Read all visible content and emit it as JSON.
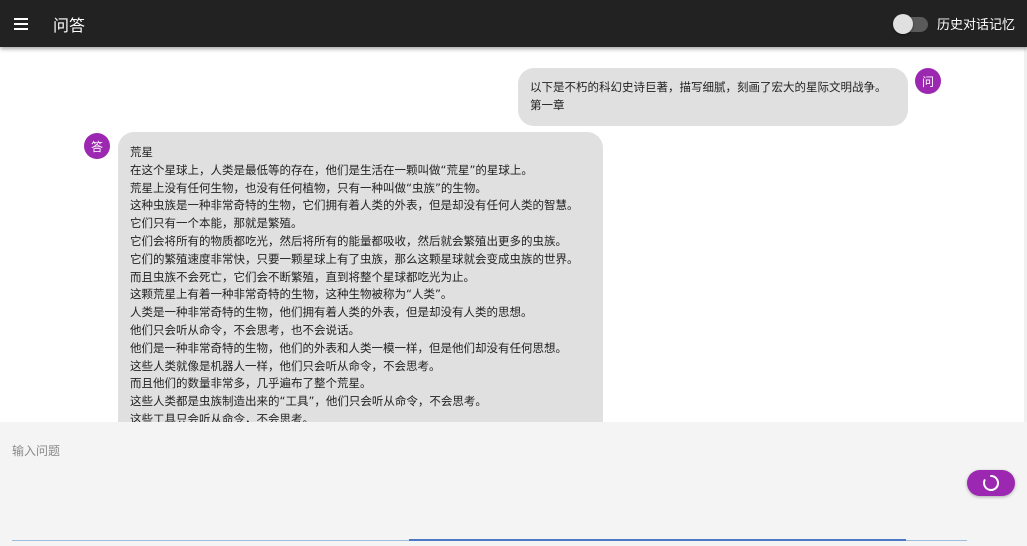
{
  "appbar": {
    "title": "问答",
    "menu_icon": "menu-icon",
    "history_toggle": {
      "label": "历史对话记忆",
      "on": false
    }
  },
  "chat": {
    "question": {
      "avatar": "问",
      "lines": [
        "以下是不朽的科幻史诗巨著，描写细腻，刻画了宏大的星际文明战争。",
        "第一章"
      ]
    },
    "answer": {
      "avatar": "答",
      "lines": [
        "荒星",
        "在这个星球上，人类是最低等的存在，他们是生活在一颗叫做“荒星”的星球上。",
        "荒星上没有任何生物，也没有任何植物，只有一种叫做“虫族”的生物。",
        "这种虫族是一种非常奇特的生物，它们拥有着人类的外表，但是却没有任何人类的智慧。",
        "它们只有一个本能，那就是繁殖。",
        "它们会将所有的物质都吃光，然后将所有的能量都吸收，然后就会繁殖出更多的虫族。",
        "它们的繁殖速度非常快，只要一颗星球上有了虫族，那么这颗星球就会变成虫族的世界。",
        "而且虫族不会死亡，它们会不断繁殖，直到将整个星球都吃光为止。",
        "这颗荒星上有着一种非常奇特的生物，这种生物被称为“人类”。",
        "人类是一种非常奇特的生物，他们拥有着人类的外表，但是却没有人类的思想。",
        "他们只会听从命令，不会思考，也不会说话。",
        "他们是一种非常奇特的生物，他们的外表和人类一模一样，但是他们却没有任何思想。",
        "这些人类就像是机器人一样，他们只会听从命令，不会思考。",
        "而且他们的数量非常多，几乎遍布了整个荒星。",
        "这些人类都是虫族制造出来的“工具”，他们只会听从命令，不会思考。",
        "这些工具只会听从命令，不会思考。"
      ]
    }
  },
  "input": {
    "placeholder": "输入问题",
    "value": ""
  },
  "send_button": {
    "icon": "loading-spinner-icon"
  },
  "colors": {
    "appbar": "#222222",
    "accent": "#9c27b0",
    "bubble": "#e0e0e0",
    "focus_line": "#4a78c2"
  }
}
